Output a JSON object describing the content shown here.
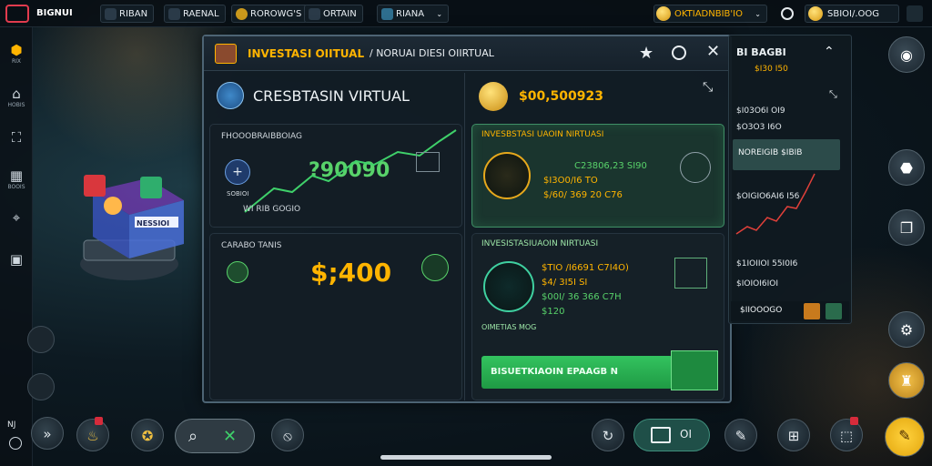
{
  "topbar": {
    "logo_text": "BIGNUI",
    "items": [
      {
        "label": "RIBAN",
        "icon": "chart-icon"
      },
      {
        "label": "RAENAL",
        "icon": "grid-icon"
      },
      {
        "label": "ROROWG'S",
        "icon": "coin-icon"
      },
      {
        "label": "ORTAIN",
        "icon": "trophy-icon"
      },
      {
        "label": "RIANA",
        "icon": "hourglass-icon"
      }
    ],
    "balance": "OKTIADNBIB'IO",
    "balance2": "SBIOI/.OOG"
  },
  "rail": {
    "items": [
      {
        "icon": "shield-icon",
        "label": "RIX"
      },
      {
        "icon": "home-icon",
        "label": "HOBIS"
      },
      {
        "icon": "expand-icon",
        "label": ""
      },
      {
        "icon": "store-icon",
        "label": "BOOIS"
      },
      {
        "icon": "bank-icon",
        "label": ""
      },
      {
        "icon": "wallet-icon",
        "label": ""
      }
    ],
    "lower_label": "NJ"
  },
  "panel": {
    "title": "INVESTASI OIITUAL",
    "title_sub": "/ NORUAI DIESI OIIRTUAL",
    "header_text": "CRESBTASIN VIRTUAL",
    "balance_value": "$00,500923",
    "growth_card": {
      "label": "FHOOOBRAIBBOIAG",
      "value": "?90090",
      "sub": "SOBIOI",
      "foot": "WI RIB GOGIO"
    },
    "total_card": {
      "label": "CARABO TANIS",
      "value": "$;400"
    },
    "invest_card_1": {
      "title": "INVESBSTASI UAOIN NIRTUASI",
      "rows": [
        "C23806,23 SI90",
        "$I3O0/I6 TO",
        "$/60/ 369 20 C76"
      ]
    },
    "invest_card_2": {
      "title": "INVESISTASIUAOIN NIRTUASI",
      "rows": [
        "$TIO /I6691 C7I4O)",
        "$4/ 3I5I SI",
        "$00I/ 36 366 C7H",
        "$120"
      ],
      "foot": "OIMETIAS MOG",
      "button": "BISUETKIAOIN EPAAGB N"
    }
  },
  "rpanel": {
    "title": "BI BAGBI",
    "sub": "$I30 I50",
    "rows": [
      "$I03O6I OI9",
      "$O3O3 I6O",
      "$OIGIO6AI6 I56",
      "$1OI9I",
      "$1IOIIOI 55I0I6",
      "$IOIOI6IOI"
    ],
    "highlight": "NOREIGIB $IBIB",
    "footer": "$IIOOOGO"
  },
  "bottom": {
    "center_pill": "OI",
    "cube_label": "NESSIOI"
  },
  "colors": {
    "accent": "#ffb400",
    "green": "#3fd06a",
    "panel": "#131d25",
    "danger": "#e23b4e"
  }
}
